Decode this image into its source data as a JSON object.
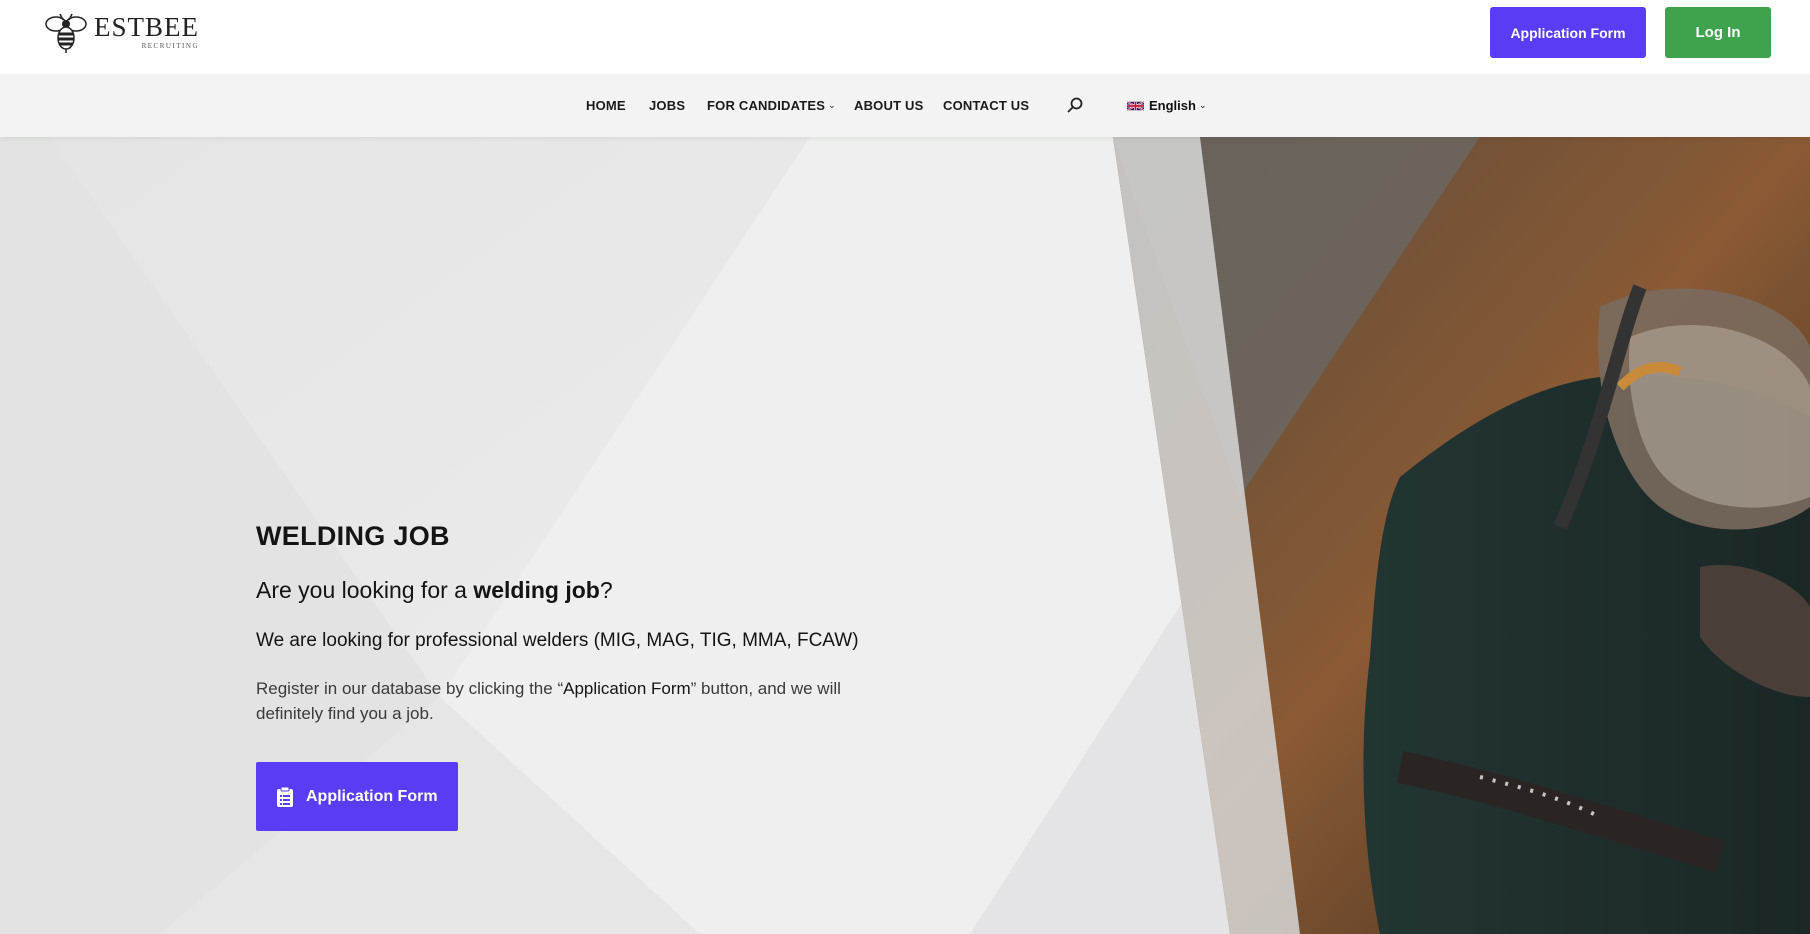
{
  "header": {
    "logo_name": "ESTBEE",
    "logo_sub": "RECRUITING",
    "application_button": "Application Form",
    "login_button": "Log In"
  },
  "nav": {
    "items": [
      {
        "label": "HOME",
        "active": false
      },
      {
        "label": "JOBS",
        "active": true
      },
      {
        "label": "FOR CANDIDATES",
        "active": false,
        "dropdown": true
      },
      {
        "label": "ABOUT US",
        "active": false
      },
      {
        "label": "CONTACT US",
        "active": false
      }
    ],
    "language": "English"
  },
  "hero": {
    "title": "WELDING JOB",
    "question_prefix": "Are you looking for a ",
    "question_bold": "welding job",
    "question_suffix": "?",
    "subtitle": "We are looking for professional welders (MIG, MAG, TIG, MMA, FCAW)",
    "body_prefix": "Register in our database by clicking the “",
    "body_emphasis": "Application Form",
    "body_suffix": "” button, and we will definitely find you a job.",
    "cta_label": "Application Form"
  },
  "colors": {
    "primary": "#5b3cf5",
    "login_green": "#3fa34d",
    "nav_bg": "#f3f3f3",
    "hero_bg": "#eeefee"
  },
  "icons": [
    "bee-logo-icon",
    "search-icon",
    "uk-flag-icon",
    "chevron-down-icon",
    "clipboard-icon"
  ]
}
